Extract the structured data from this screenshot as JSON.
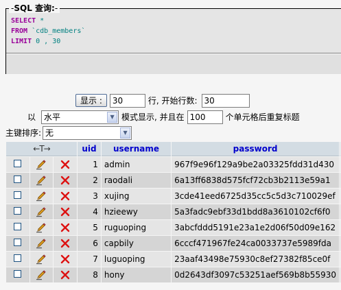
{
  "sql_panel": {
    "legend_title": "SQL 查询:",
    "lines": [
      {
        "keyword": "SELECT",
        "rest": " *"
      },
      {
        "keyword": "FROM",
        "rest": " `cdb_members`"
      },
      {
        "keyword": "LIMIT",
        "rest": " 0 , 30"
      }
    ]
  },
  "controls": {
    "show_button": "显示 :",
    "row_count": "30",
    "rows_label": "行, 开始行数:",
    "start_row": "30",
    "mode_prefix": "以",
    "mode_value": "水平",
    "mode_suffix": "模式显示, 并且在",
    "repeat_count": "100",
    "repeat_suffix": "个单元格后重复标题",
    "sort_label": "主键排序:",
    "sort_value": "无"
  },
  "table": {
    "action_header": "←T→",
    "columns": [
      "uid",
      "username",
      "password"
    ],
    "rows": [
      {
        "uid": "1",
        "username": "admin",
        "password": "967f9e96f129a9be2a03325fdd31d430"
      },
      {
        "uid": "2",
        "username": "raodali",
        "password": "6a13ff6838d575fcf72cb3b2113e59a1"
      },
      {
        "uid": "3",
        "username": "xujing",
        "password": "3cde41eed6725d35cc5c5d3c710029ef"
      },
      {
        "uid": "4",
        "username": "hzieewy",
        "password": "5a3fadc9ebf33d1bdd8a3610102cf6f0"
      },
      {
        "uid": "5",
        "username": "ruguoping",
        "password": "3abcfddd5191e23a1e2d06f50d09e162"
      },
      {
        "uid": "6",
        "username": "capbily",
        "password": "6cccf471967fe24ca0033737e5989fda"
      },
      {
        "uid": "7",
        "username": "luguoping",
        "password": "23aaf43498e75930c8ef27382f85ce0f"
      },
      {
        "uid": "8",
        "username": "hony",
        "password": "0d2643df3097c53251aef569b8b55930"
      }
    ]
  },
  "colors": {
    "header_bg": "#d3dce3",
    "header_text": "#0000cc",
    "row_odd": "#e5e5e5",
    "row_even": "#d5d5d5",
    "sql_keyword": "#990099",
    "sql_literal": "#008080"
  },
  "icons": {
    "edit": "pencil-icon",
    "delete": "red-x-icon"
  }
}
